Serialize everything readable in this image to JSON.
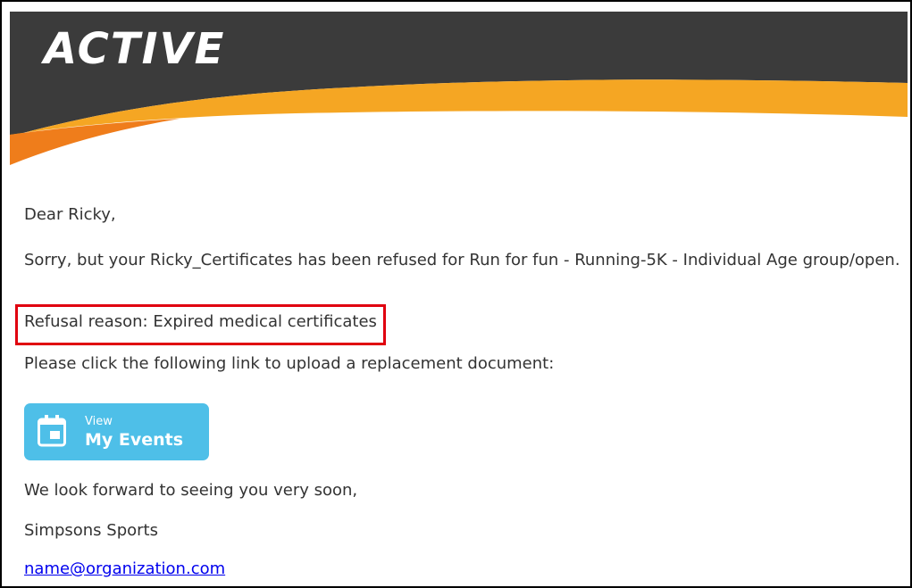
{
  "header": {
    "logo_text": "ACTIVE",
    "colors": {
      "dark": "#3b3b3b",
      "orange": "#f5a623",
      "deep_orange": "#ef7d1b"
    }
  },
  "email": {
    "greeting": "Dear Ricky,",
    "message": "Sorry, but your Ricky_Certificates has been refused for Run for fun - Running-5K - Individual Age group/open.",
    "refusal_reason": "Refusal reason: Expired medical certificates",
    "instruction": "Please click the following link to upload a replacement document:",
    "button": {
      "small_label": "View",
      "main_label": "My Events",
      "icon": "calendar-icon",
      "color": "#4ebfe8"
    },
    "closing": "We look forward to seeing you very soon,",
    "signature": "Simpsons Sports",
    "contact_email": "name@organization.com"
  },
  "highlight_color": "#e0000f"
}
